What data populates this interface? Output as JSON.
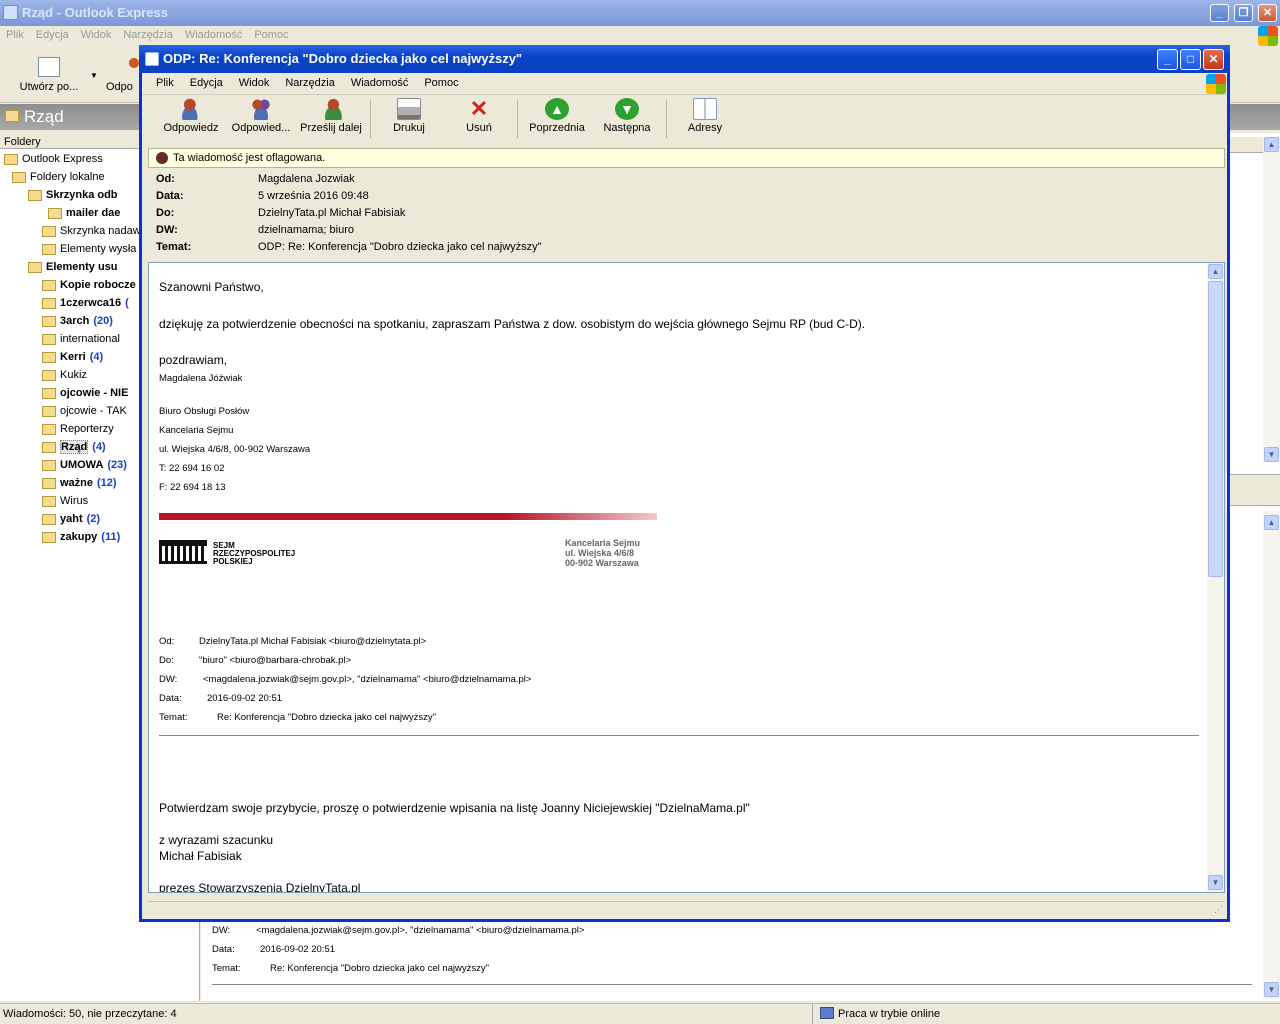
{
  "main_window": {
    "title": "Rząd - Outlook Express",
    "menu": [
      "Plik",
      "Edycja",
      "Widok",
      "Narzędzia",
      "Wiadomość",
      "Pomoc"
    ],
    "toolbar": {
      "create_label": "Utwórz po...",
      "reply_label": "Odpo"
    },
    "folder_header": "Rząd",
    "folders_title": "Foldery",
    "folders": [
      {
        "label": "Outlook Express",
        "bold": false,
        "count": "",
        "icon": "outlook-express-icon"
      },
      {
        "label": "Foldery lokalne",
        "bold": false,
        "count": "",
        "icon": "local-folders-icon"
      },
      {
        "label": "Skrzynka odb",
        "bold": true,
        "count": "",
        "icon": "inbox-icon"
      },
      {
        "label": "mailer dae",
        "bold": true,
        "count": "",
        "icon": "folder-icon"
      },
      {
        "label": "Skrzynka nadaw",
        "bold": false,
        "count": "",
        "icon": "outbox-icon"
      },
      {
        "label": "Elementy wysła",
        "bold": false,
        "count": "",
        "icon": "sent-items-icon"
      },
      {
        "label": "Elementy usu",
        "bold": true,
        "count": "",
        "icon": "deleted-items-icon"
      },
      {
        "label": "Kopie robocze",
        "bold": true,
        "count": "",
        "icon": "drafts-icon"
      },
      {
        "label": "1czerwca16",
        "bold": true,
        "count": "(",
        "icon": "folder-icon"
      },
      {
        "label": "3arch",
        "bold": true,
        "count": "(20)",
        "icon": "folder-icon"
      },
      {
        "label": "international",
        "bold": false,
        "count": "",
        "icon": "folder-icon"
      },
      {
        "label": "Kerri",
        "bold": true,
        "count": "(4)",
        "icon": "folder-icon"
      },
      {
        "label": "Kukiz",
        "bold": false,
        "count": "",
        "icon": "folder-icon"
      },
      {
        "label": "ojcowie - NIE",
        "bold": true,
        "count": "",
        "icon": "folder-icon"
      },
      {
        "label": "ojcowie - TAK",
        "bold": false,
        "count": "",
        "icon": "folder-icon"
      },
      {
        "label": "Reporterzy",
        "bold": false,
        "count": "",
        "icon": "folder-icon"
      },
      {
        "label": "Rząd",
        "bold": true,
        "count": "(4)",
        "icon": "folder-icon"
      },
      {
        "label": "UMOWA",
        "bold": true,
        "count": "(23)",
        "icon": "folder-icon"
      },
      {
        "label": "ważne",
        "bold": true,
        "count": "(12)",
        "icon": "folder-icon"
      },
      {
        "label": "Wirus",
        "bold": false,
        "count": "",
        "icon": "folder-icon"
      },
      {
        "label": "yaht",
        "bold": true,
        "count": "(2)",
        "icon": "folder-icon"
      },
      {
        "label": "zakupy",
        "bold": true,
        "count": "(11)",
        "icon": "folder-icon"
      }
    ],
    "preview_tail": {
      "dw_label": "DW:",
      "dw_value": "<magdalena.jozwiak@sejm.gov.pl>, \"dzielnamama\" <biuro@dzielnamama.pl>",
      "data_label": "Data:",
      "data_value": "2016-09-02 20:51",
      "temat_label": "Temat:",
      "temat_value": "Re: Konferencja \"Dobro dziecka jako cel najwyższy\""
    },
    "status_left": "Wiadomości: 50, nie przeczytane: 4",
    "status_right": "Praca w trybie online"
  },
  "message_window": {
    "title": "ODP: Re: Konferencja \"Dobro dziecka jako cel najwyższy\"",
    "menu": [
      "Plik",
      "Edycja",
      "Widok",
      "Narzędzia",
      "Wiadomość",
      "Pomoc"
    ],
    "toolbar": [
      {
        "label": "Odpowiedz",
        "icon": "reply-icon"
      },
      {
        "label": "Odpowied...",
        "icon": "reply-all-icon"
      },
      {
        "label": "Prześlij dalej",
        "icon": "forward-icon"
      },
      {
        "label": "Drukuj",
        "icon": "print-icon"
      },
      {
        "label": "Usuń",
        "icon": "delete-icon"
      },
      {
        "label": "Poprzednia",
        "icon": "previous-icon"
      },
      {
        "label": "Następna",
        "icon": "next-icon"
      },
      {
        "label": "Adresy",
        "icon": "address-book-icon"
      }
    ],
    "flag_text": "Ta wiadomość jest oflagowana.",
    "headers": [
      {
        "k": "Od:",
        "v": "Magdalena Jozwiak"
      },
      {
        "k": "Data:",
        "v": "5 września 2016 09:48"
      },
      {
        "k": "Do:",
        "v": "DzielnyTata.pl Michał Fabisiak"
      },
      {
        "k": "DW:",
        "v": "dzielnamama; biuro"
      },
      {
        "k": "Temat:",
        "v": "ODP: Re: Konferencja \"Dobro dziecka jako cel najwyższy\""
      }
    ],
    "body": {
      "greeting": "Szanowni Państwo,",
      "para1": "dziękuję za potwierdzenie obecności na spotkaniu, zapraszam Państwa z dow. osobistym do wejścia głównego Sejmu RP (bud C-D).",
      "regards": "pozdrawiam,",
      "sig_name": "Magdalena Jóźwiak",
      "sig_lines": [
        "Biuro Obsługi Posłów",
        "Kancelaria Sejmu",
        "ul. Wiejska 4/6/8, 00-902 Warszawa",
        "T: 22 694 16 02",
        "F: 22 694 18 13"
      ],
      "logo_text": [
        "SEJM",
        "RZECZYPOSPOLITEJ",
        "POLSKIEJ"
      ],
      "logo_right": [
        "Kancelaria Sejmu",
        "ul. Wiejska 4/6/8",
        "00-902 Warszawa"
      ],
      "quoted": [
        {
          "k": "Od:",
          "v": "DzielnyTata.pl Michał Fabisiak <biuro@dzielnytata.pl>"
        },
        {
          "k": "Do:",
          "v": "\"biuro\" <biuro@barbara-chrobak.pl>"
        },
        {
          "k": "DW:",
          "v": "<magdalena.jozwiak@sejm.gov.pl>, \"dzielnamama\" <biuro@dzielnamama.pl>"
        },
        {
          "k": "Data:",
          "v": "2016-09-02 20:51"
        },
        {
          "k": "Temat:",
          "v": "Re: Konferencja \"Dobro dziecka jako cel najwyższy\""
        }
      ],
      "para2": "Potwierdzam swoje przybycie, proszę o potwierdzenie wpisania na listę Joanny Niciejewskiej \"DzielnaMama.pl\"",
      "closing1": "z wyrazami szacunku",
      "closing2": "Michał Fabisiak",
      "closing3": "prezes Stowarzyszenia DzielnyTata.pl"
    }
  },
  "colors": {
    "accent": "#0a43c8",
    "flag_bg": "#ffffe1",
    "sejm_red": "#b7162b"
  }
}
